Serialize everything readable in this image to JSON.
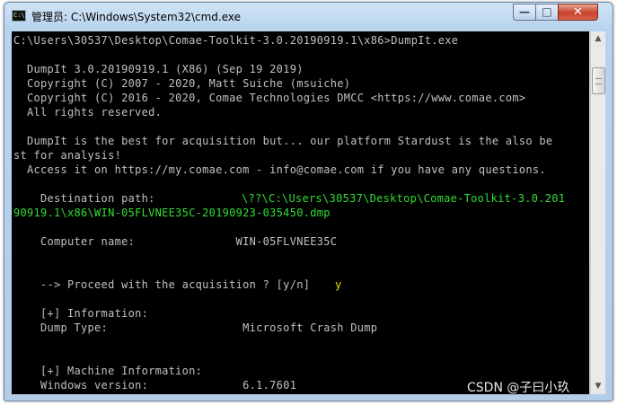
{
  "window": {
    "title": "管理员: C:\\Windows\\System32\\cmd.exe",
    "controls": {
      "minimize": "—",
      "maximize": "□",
      "close": "✕"
    }
  },
  "console": {
    "lines": [
      "C:\\Users\\30537\\Desktop\\Comae-Toolkit-3.0.20190919.1\\x86>DumpIt.exe",
      "",
      "  DumpIt 3.0.20190919.1 (X86) (Sep 19 2019)",
      "  Copyright (C) 2007 - 2020, Matt Suiche (msuiche)",
      "  Copyright (C) 2016 - 2020, Comae Technologies DMCC <https://www.comae.com>",
      "  All rights reserved.",
      "",
      "  DumpIt is the best for acquisition but... our platform Stardust is the also be",
      "st for analysis!",
      "  Access it on https://my.comae.com - info@comae.com if you have any questions.",
      "",
      "    Destination path:",
      "",
      "",
      "",
      "    Computer name:               WIN-05FLVNEE35C",
      "",
      "",
      "    --> Proceed with the acquisition ? [y/n]",
      "",
      "    [+] Information:",
      "    Dump Type:                    Microsoft Crash Dump",
      "",
      "",
      "    [+] Machine Information:",
      "    Windows version:              6.1.7601"
    ],
    "destination_value_1": "\\??\\C:\\Users\\30537\\Desktop\\Comae-Toolkit-3.0.201",
    "destination_value_2": "90919.1\\x86\\WIN-05FLVNEE35C-20190923-035450.dmp",
    "proceed_answer": "y"
  },
  "watermark": "CSDN @子曰小玖"
}
